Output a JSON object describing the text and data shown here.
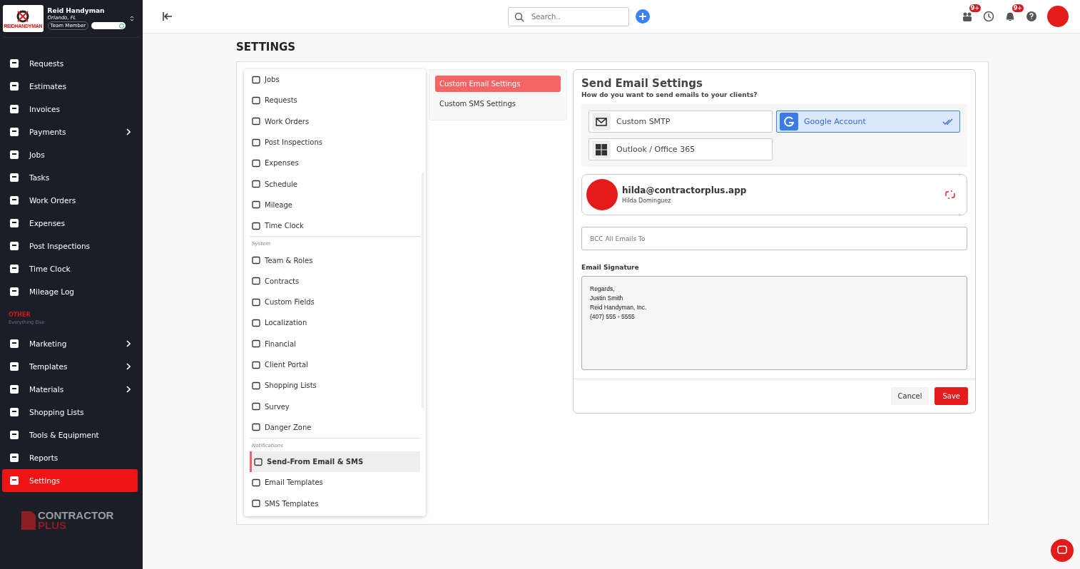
{
  "company": {
    "name": "Reid Handyman",
    "location": "Orlando, FL",
    "role": "Team Member",
    "logo_text": "REIDHANDYMAN"
  },
  "sidebar": {
    "items": [
      {
        "label": "Requests",
        "has_submenu": false,
        "selected": false
      },
      {
        "label": "Estimates",
        "has_submenu": false,
        "selected": false
      },
      {
        "label": "Invoices",
        "has_submenu": false,
        "selected": false
      },
      {
        "label": "Payments",
        "has_submenu": true,
        "selected": false
      },
      {
        "label": "Jobs",
        "has_submenu": false,
        "selected": false
      },
      {
        "label": "Tasks",
        "has_submenu": false,
        "selected": false
      },
      {
        "label": "Work Orders",
        "has_submenu": false,
        "selected": false
      },
      {
        "label": "Expenses",
        "has_submenu": false,
        "selected": false
      },
      {
        "label": "Post Inspections",
        "has_submenu": false,
        "selected": false
      },
      {
        "label": "Time Clock",
        "has_submenu": false,
        "selected": false
      },
      {
        "label": "Mileage Log",
        "has_submenu": false,
        "selected": false
      }
    ],
    "section": {
      "title": "OTHER",
      "subtitle": "Everything Else"
    },
    "other_items": [
      {
        "label": "Marketing",
        "has_submenu": true,
        "selected": false
      },
      {
        "label": "Templates",
        "has_submenu": true,
        "selected": false
      },
      {
        "label": "Materials",
        "has_submenu": true,
        "selected": false
      },
      {
        "label": "Shopping Lists",
        "has_submenu": false,
        "selected": false
      },
      {
        "label": "Tools & Equipment",
        "has_submenu": false,
        "selected": false
      },
      {
        "label": "Reports",
        "has_submenu": false,
        "selected": false
      },
      {
        "label": "Settings",
        "has_submenu": false,
        "selected": true
      }
    ],
    "brand": {
      "line1": "CONTRACTOR",
      "line2": "PLUS"
    }
  },
  "topbar": {
    "search": {
      "placeholder": "Search.."
    },
    "badges": [
      "9+",
      "9+"
    ]
  },
  "page_title": "SETTINGS",
  "settings_menu": {
    "groups": [
      {
        "items": [
          {
            "label": "Jobs",
            "selected": false
          },
          {
            "label": "Requests",
            "selected": false
          },
          {
            "label": "Work Orders",
            "selected": false
          },
          {
            "label": "Post Inspections",
            "selected": false
          },
          {
            "label": "Expenses",
            "selected": false
          },
          {
            "label": "Schedule",
            "selected": false
          },
          {
            "label": "Mileage",
            "selected": false
          },
          {
            "label": "Time Clock",
            "selected": false
          }
        ]
      },
      {
        "title": "System",
        "items": [
          {
            "label": "Team & Roles",
            "selected": false
          },
          {
            "label": "Contracts",
            "selected": false
          },
          {
            "label": "Custom Fields",
            "selected": false
          },
          {
            "label": "Localization",
            "selected": false
          },
          {
            "label": "Financial",
            "selected": false
          },
          {
            "label": "Client Portal",
            "selected": false
          },
          {
            "label": "Shopping Lists",
            "selected": false
          },
          {
            "label": "Survey",
            "selected": false
          },
          {
            "label": "Danger Zone",
            "selected": false
          }
        ]
      },
      {
        "title": "Notifications",
        "items": [
          {
            "label": "Send-From Email & SMS",
            "selected": true
          },
          {
            "label": "Email Templates",
            "selected": false
          },
          {
            "label": "SMS Templates",
            "selected": false
          }
        ]
      }
    ]
  },
  "sub_tabs": [
    {
      "label": "Custom Email Settings",
      "selected": true
    },
    {
      "label": "Custom SMS Settings",
      "selected": false
    }
  ],
  "email_settings": {
    "title": "Send Email Settings",
    "subtitle": "How do you want to send emails to your clients?",
    "providers": [
      {
        "kind": "smtp",
        "label": "Custom SMTP",
        "selected": false
      },
      {
        "kind": "google",
        "label": "Google Account",
        "selected": true
      },
      {
        "kind": "outlook",
        "label": "Outlook / Office 365",
        "selected": false
      }
    ],
    "account": {
      "email": "hilda@contractorplus.app",
      "name": "Hilda Dominguez"
    },
    "bcc": {
      "placeholder": "BCC All Emails To"
    },
    "signature": {
      "label": "Email Signature",
      "lines": [
        "Regards,",
        "Justin Smith",
        "Reid Handyman, Inc.",
        "(407) 555 - 5555"
      ]
    },
    "buttons": {
      "cancel": "Cancel",
      "save": "Save"
    }
  }
}
